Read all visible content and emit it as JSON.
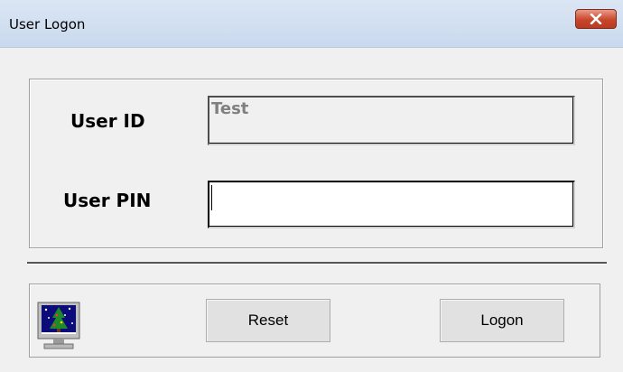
{
  "window": {
    "title": "User Logon",
    "close_icon": "close-x-icon",
    "close_color": "#c9462c"
  },
  "form": {
    "user_id_label": "User ID",
    "user_id_value": "Test",
    "user_pin_label": "User PIN",
    "user_pin_value": ""
  },
  "footer": {
    "app_icon": "monitor-christmas-tree-icon",
    "reset_label": "Reset",
    "logon_label": "Logon"
  }
}
